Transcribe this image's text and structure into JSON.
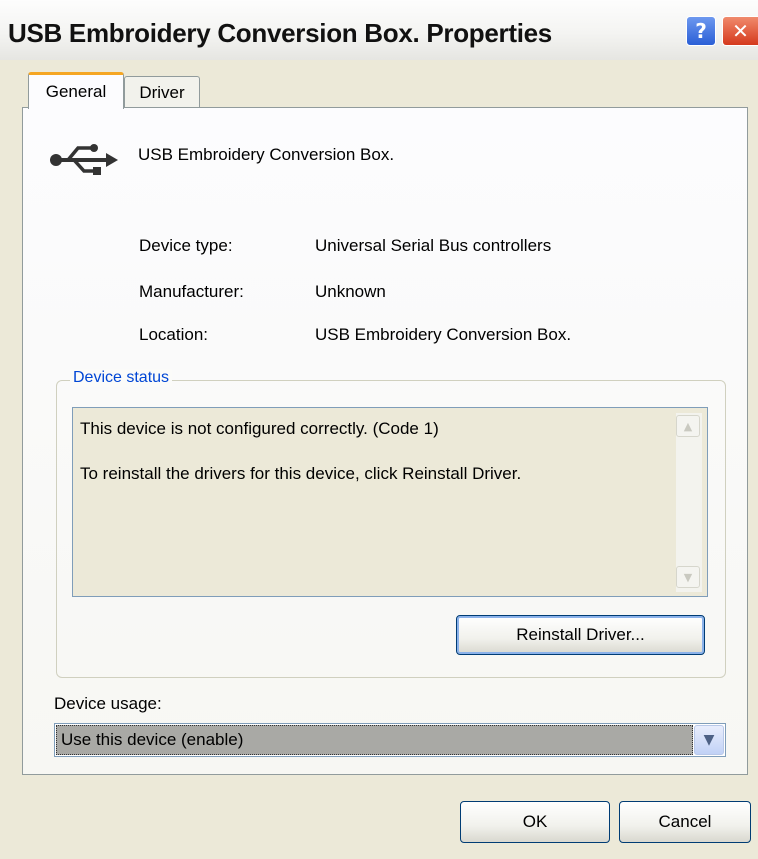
{
  "window": {
    "title": "USB Embroidery Conversion Box. Properties",
    "help_button": "?",
    "close_button": "✕"
  },
  "tabs": [
    {
      "label": "General",
      "selected": true
    },
    {
      "label": "Driver",
      "selected": false
    }
  ],
  "device": {
    "icon": "usb-icon",
    "name": "USB Embroidery Conversion Box."
  },
  "properties": [
    {
      "label": "Device type:",
      "value": "Universal Serial Bus controllers"
    },
    {
      "label": "Manufacturer:",
      "value": "Unknown"
    },
    {
      "label": "Location:",
      "value": "USB Embroidery Conversion Box."
    }
  ],
  "device_status": {
    "legend": "Device status",
    "lines": [
      "This device is not configured correctly. (Code 1)",
      "To reinstall the drivers for this device, click Reinstall Driver."
    ],
    "reinstall_button": "Reinstall Driver..."
  },
  "device_usage": {
    "label": "Device usage:",
    "selected": "Use this device (enable)"
  },
  "footer": {
    "ok_label": "OK",
    "cancel_label": "Cancel"
  },
  "colors": {
    "dialog_bg": "#ece9d8",
    "accent_tab": "#f5a623",
    "legend_blue": "#0046d5",
    "button_border": "#003c74"
  }
}
